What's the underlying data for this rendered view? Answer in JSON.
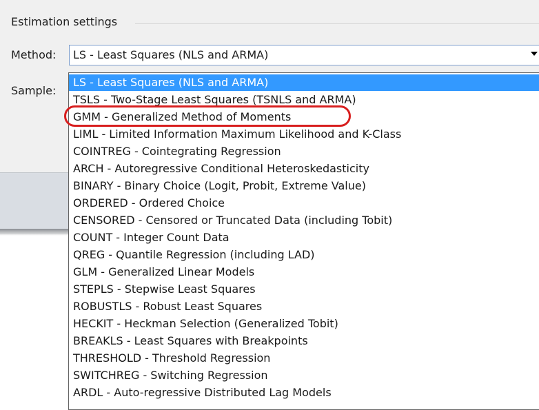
{
  "settings": {
    "group_title": "Estimation settings",
    "method_label": "Method:",
    "sample_label": "Sample:",
    "method_value": "LS  -  Least Squares (NLS and ARMA)"
  },
  "dropdown": {
    "options": [
      "LS  -  Least Squares (NLS and ARMA)",
      "TSLS  -  Two-Stage Least Squares (TSNLS and ARMA)",
      "GMM  -  Generalized Method of Moments",
      "LIML  -  Limited Information Maximum Likelihood and K-Class",
      "COINTREG  -  Cointegrating Regression",
      "ARCH  -  Autoregressive Conditional Heteroskedasticity",
      "BINARY  -  Binary Choice (Logit, Probit, Extreme Value)",
      "ORDERED  -  Ordered Choice",
      "CENSORED  -  Censored or Truncated Data (including Tobit)",
      "COUNT  -  Integer Count Data",
      "QREG  -  Quantile Regression (including LAD)",
      "GLM  -  Generalized Linear Models",
      "STEPLS  -  Stepwise Least Squares",
      "ROBUSTLS  -  Robust Least Squares",
      "HECKIT  -  Heckman Selection (Generalized Tobit)",
      "BREAKLS  -  Least Squares with Breakpoints",
      "THRESHOLD  -  Threshold Regression",
      "SWITCHREG  -  Switching Regression",
      "ARDL - Auto-regressive Distributed Lag Models"
    ],
    "selected_index": 0,
    "annotated_index": 2
  },
  "colors": {
    "selection": "#3399ff",
    "annotation_ring": "#d81e1e"
  }
}
